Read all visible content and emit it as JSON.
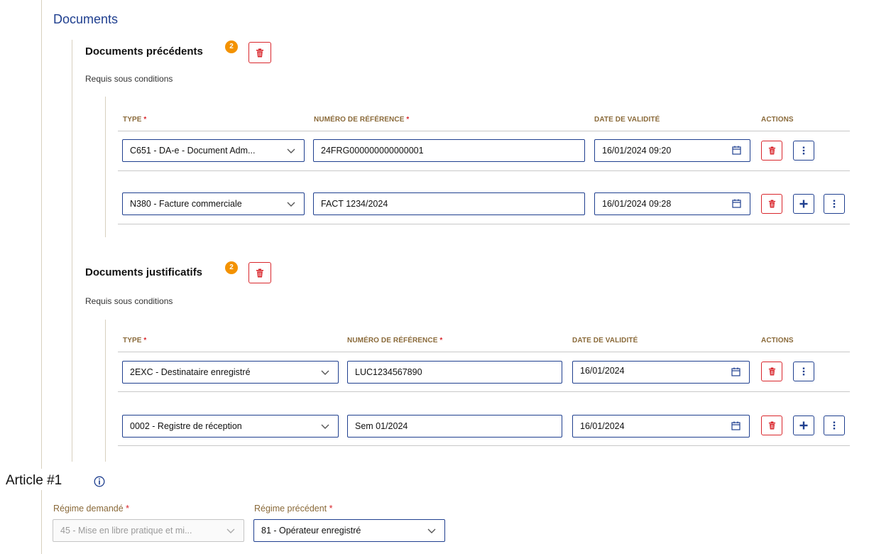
{
  "section_title": "Documents",
  "groups": [
    {
      "title": "Documents précédents",
      "badge": "2",
      "subtitle": "Requis sous conditions",
      "headers": {
        "type": "TYPE",
        "ref": "NUMÉRO DE RÉFÉRENCE",
        "date": "DATE DE VALIDITÉ",
        "actions": "ACTIONS",
        "required_mark": "*"
      },
      "rows": [
        {
          "type": "C651 - DA-e - Document Adm...",
          "ref": "24FRG000000000000001",
          "date": "16/01/2024 09:20"
        },
        {
          "type": "N380 - Facture commerciale",
          "ref": "FACT 1234/2024",
          "date": "16/01/2024 09:28"
        }
      ]
    },
    {
      "title": "Documents justificatifs",
      "badge": "2",
      "subtitle": "Requis sous conditions",
      "headers": {
        "type": "TYPE",
        "ref": "NUMÉRO DE RÉFÉRENCE",
        "date": "DATE DE VALIDITÉ",
        "actions": "ACTIONS",
        "required_mark": "*"
      },
      "rows": [
        {
          "type": "2EXC - Destinataire enregistré",
          "ref": "LUC1234567890",
          "date": "16/01/2024"
        },
        {
          "type": "0002 - Registre de réception",
          "ref": "Sem 01/2024",
          "date": "16/01/2024"
        }
      ]
    }
  ],
  "article": {
    "title": "Article #1",
    "regime_demande_label": "Régime demandé",
    "regime_demande_value": "45 - Mise en libre pratique et mi...",
    "regime_precedent_label": "Régime précédent",
    "regime_precedent_value": "81 - Opérateur enregistré",
    "required_mark": "*"
  },
  "colors": {
    "primary": "#1f3f8f",
    "danger": "#d9262c",
    "badge": "#f39200",
    "label_brown": "#8a6a3a"
  },
  "icons": {
    "delete": "trash-icon",
    "add": "plus-icon",
    "more": "kebab-icon",
    "calendar": "calendar-icon",
    "dropdown": "chevron-down-icon",
    "info": "info-icon"
  }
}
